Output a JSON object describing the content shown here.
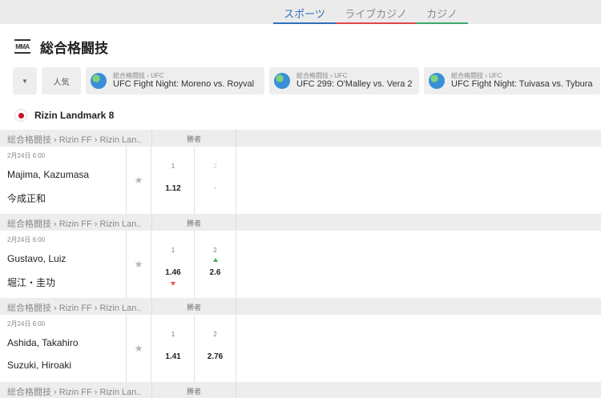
{
  "topnav": {
    "tabs": [
      {
        "label": "スポーツ",
        "color": "#2f6fb8"
      },
      {
        "label": "ライブカジノ",
        "color": "#e0464a"
      },
      {
        "label": "カジノ",
        "color": "#3aa86a"
      }
    ]
  },
  "header": {
    "icon": "mma-icon",
    "icon_text": "MMA",
    "title": "総合格闘技"
  },
  "filters": {
    "dropdown_icon": "chevron-down-icon",
    "popular_label": "人気",
    "chips": [
      {
        "path": "総合格闘技 › UFC",
        "name": "UFC Fight Night: Moreno vs. Royval"
      },
      {
        "path": "総合格闘技 › UFC",
        "name": "UFC 299: O'Malley vs. Vera 2"
      },
      {
        "path": "総合格闘技 › UFC",
        "name": "UFC Fight Night: Tuivasa vs. Tybura"
      }
    ]
  },
  "league": {
    "flag": "japan-flag-icon",
    "name": "Rizin Landmark 8"
  },
  "events": [
    {
      "crumb": "総合格闘技 › Rizin FF › Rizin Lan...",
      "col_label": "勝者",
      "date": "2月24日 6:00",
      "team1": "Majima, Kazumasa",
      "team2": "今成正和",
      "odd1_label": "1",
      "odd1_value": "1.12",
      "odd1_trend": "",
      "odd2_label": "2",
      "odd2_value": "-",
      "odd2_trend": "",
      "odd2_muted": true
    },
    {
      "crumb": "総合格闘技 › Rizin FF › Rizin Lan...",
      "col_label": "勝者",
      "date": "2月24日 6:00",
      "team1": "Gustavo, Luiz",
      "team2": "堀江・圭功",
      "odd1_label": "1",
      "odd1_value": "1.46",
      "odd1_trend": "down",
      "odd2_label": "2",
      "odd2_value": "2.6",
      "odd2_trend": "up",
      "odd2_muted": false
    },
    {
      "crumb": "総合格闘技 › Rizin FF › Rizin Lan...",
      "col_label": "勝者",
      "date": "2月24日 6:00",
      "team1": "Ashida, Takahiro",
      "team2": "Suzuki, Hiroaki",
      "odd1_label": "1",
      "odd1_value": "1.41",
      "odd1_trend": "",
      "odd2_label": "2",
      "odd2_value": "2.76",
      "odd2_trend": "",
      "odd2_muted": false
    },
    {
      "crumb": "総合格闘技 › Rizin FF › Rizin Lan...",
      "col_label": "勝者"
    }
  ]
}
